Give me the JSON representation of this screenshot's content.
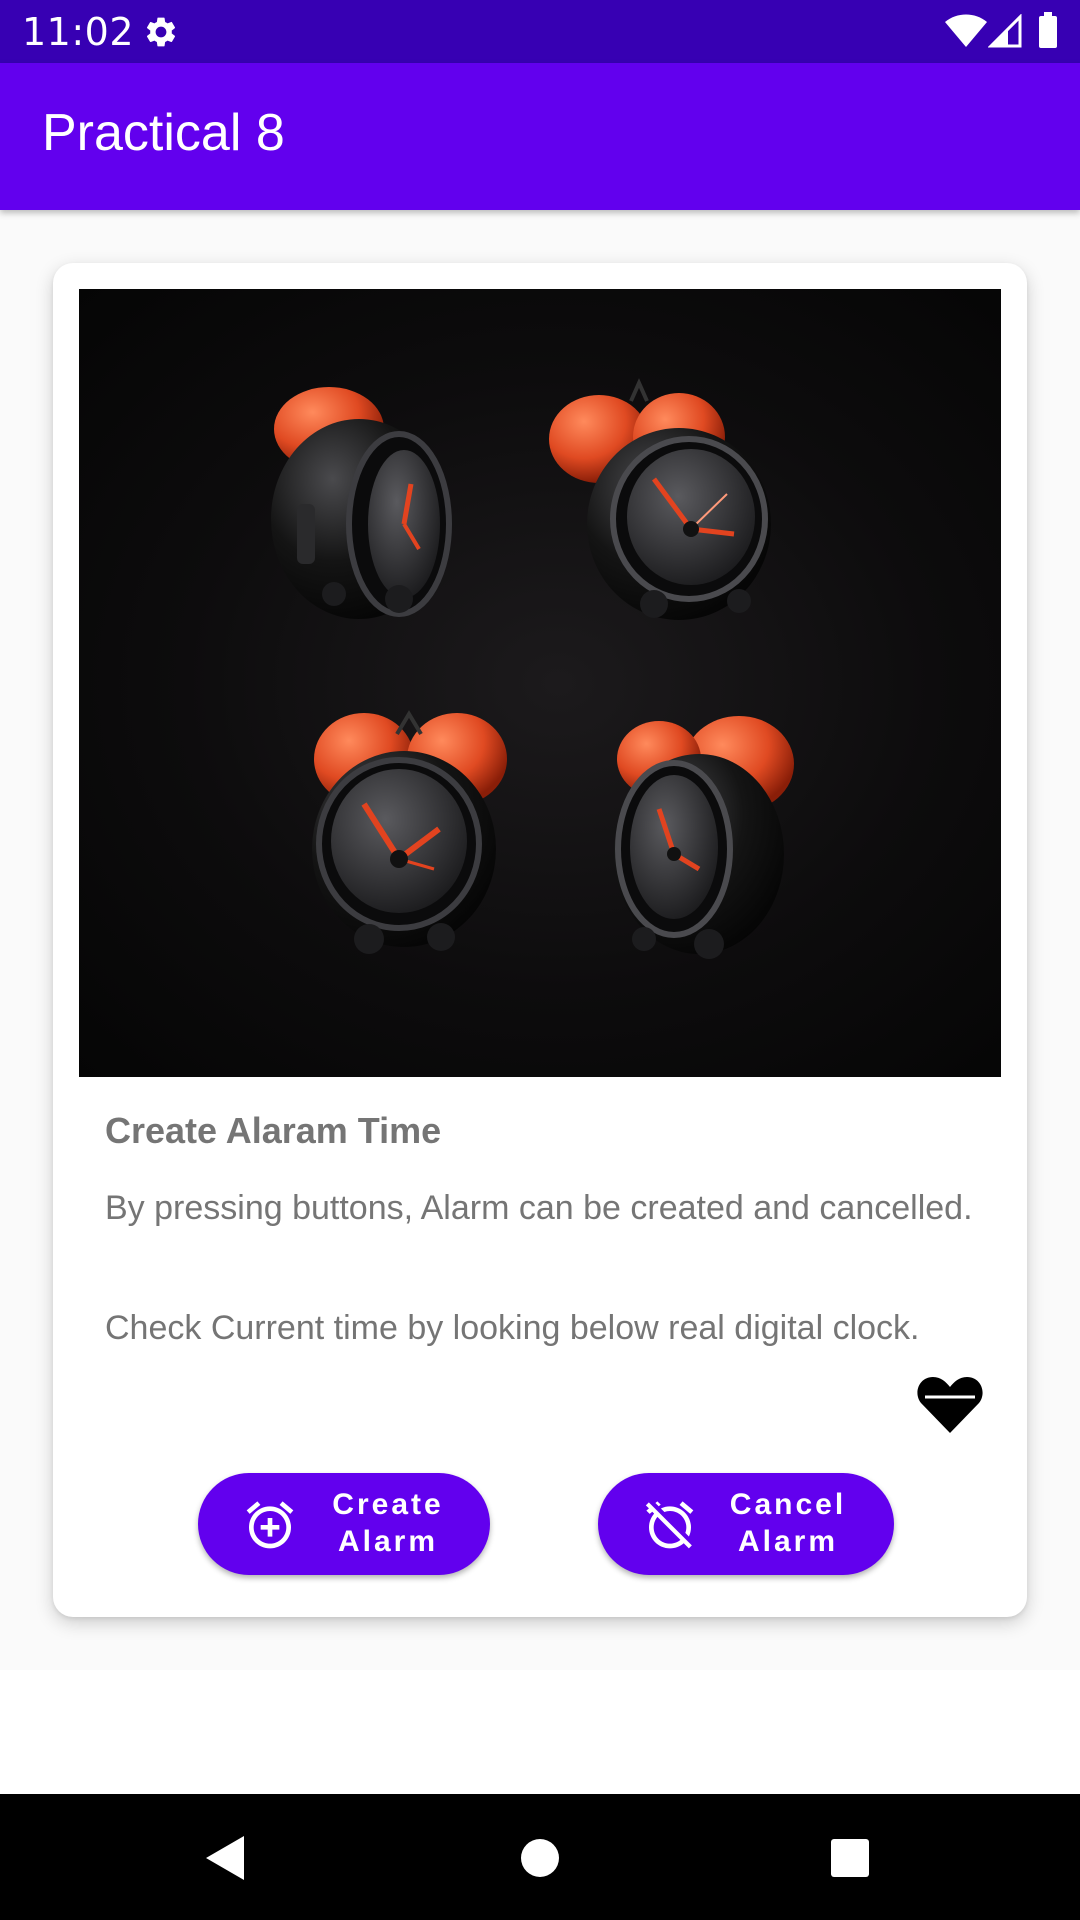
{
  "status_bar": {
    "time": "11:02",
    "icons": [
      "gear-icon",
      "wifi-icon",
      "signal-icon",
      "battery-icon"
    ]
  },
  "app_bar": {
    "title": "Practical 8",
    "color": "#6200ee"
  },
  "card": {
    "image_icon": "alarm-clocks-image",
    "title": "Create Alaram Time",
    "description": "By pressing buttons, Alarm can be created and cancelled.",
    "note": "Check Current time by looking below real digital clock.",
    "favorite_icon": "heart-icon"
  },
  "buttons": {
    "create": {
      "label": "Create\nAlarm",
      "icon": "alarm-add-icon"
    },
    "cancel": {
      "label": "Cancel\nAlarm",
      "icon": "alarm-off-icon"
    }
  },
  "nav_bar": {
    "icons": [
      "back-icon",
      "home-icon",
      "recents-icon"
    ]
  },
  "colors": {
    "status_bar": "#3700b3",
    "primary": "#6200ee",
    "text_secondary": "#757575"
  }
}
